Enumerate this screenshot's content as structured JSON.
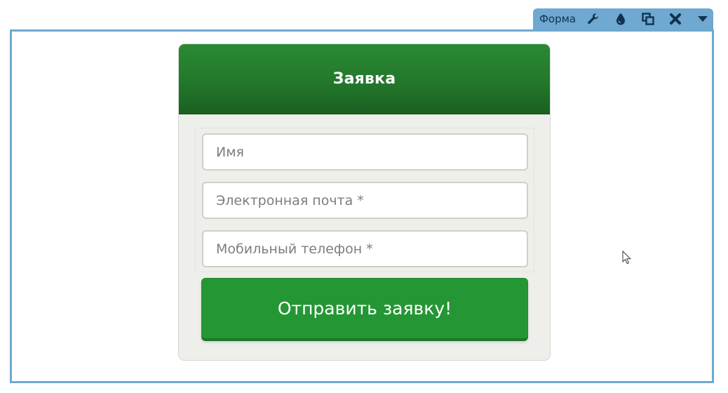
{
  "editor_toolbar": {
    "label": "Форма",
    "icons": [
      "wrench-icon",
      "drop-icon",
      "copy-icon",
      "close-icon",
      "caret-down-icon"
    ],
    "accent_color": "#6fa8d0"
  },
  "form": {
    "title": "Заявка",
    "fields": {
      "name_placeholder": "Имя",
      "email_placeholder": "Электронная почта *",
      "phone_placeholder": "Мобильный телефон *"
    },
    "submit_label": "Отправить заявку!",
    "colors": {
      "header": "#23782b",
      "button": "#259634",
      "card_background": "#eeeeea"
    }
  }
}
